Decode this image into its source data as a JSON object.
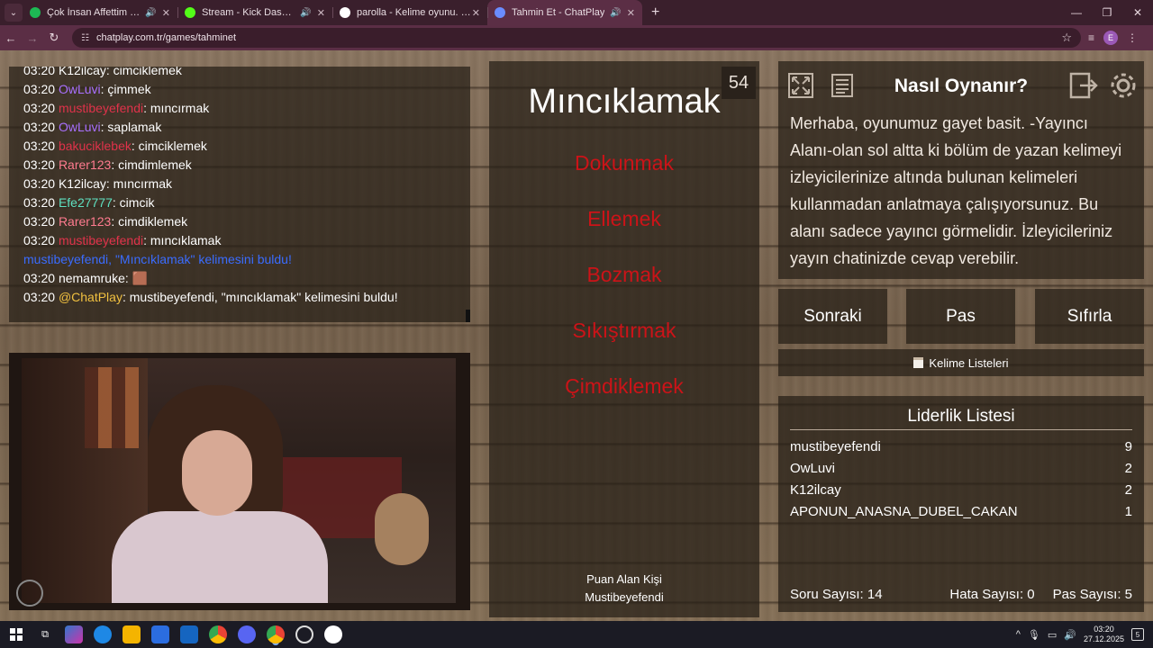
{
  "browser": {
    "tabs": [
      {
        "title": "Çok İnsan Affettim • Wegh",
        "color": "#1db954",
        "active": false
      },
      {
        "title": "Stream - Kick Dashboard",
        "color": "#53fc18",
        "active": false
      },
      {
        "title": "parolla - Kelime oyunu. Günlük",
        "color": "#ffffff",
        "active": false
      },
      {
        "title": "Tahmin Et - ChatPlay",
        "color": "#6a8cff",
        "active": true
      }
    ],
    "url": "chatplay.com.tr/games/tahminet",
    "profile_initial": "E"
  },
  "chat": {
    "lines": [
      {
        "time": "03:20",
        "user": "K12ilcay",
        "color": "#ffffff",
        "message": ": cimciklemek"
      },
      {
        "time": "03:20",
        "user": "OwLuvi",
        "color": "#a970ff",
        "message": ": çimmek"
      },
      {
        "time": "03:20",
        "user": "mustibeyefendi",
        "color": "#e0324a",
        "message": ": mıncırmak"
      },
      {
        "time": "03:20",
        "user": "OwLuvi",
        "color": "#a970ff",
        "message": ": saplamak"
      },
      {
        "time": "03:20",
        "user": "bakuciklebek",
        "color": "#e0324a",
        "message": ": cimciklemek"
      },
      {
        "time": "03:20",
        "user": "Rarer123",
        "color": "#ff7b8f",
        "message": ": cimdimlemek"
      },
      {
        "time": "03:20",
        "user": "K12ilcay",
        "color": "#ffffff",
        "message": ": mıncırmak"
      },
      {
        "time": "03:20",
        "user": "Efe27777",
        "color": "#5ee0c0",
        "message": ": cimcik"
      },
      {
        "time": "03:20",
        "user": "Rarer123",
        "color": "#ff7b8f",
        "message": ": cimdiklemek"
      },
      {
        "time": "03:20",
        "user": "mustibeyefendi",
        "color": "#e0324a",
        "message": ": mıncıklamak"
      },
      {
        "time": "",
        "user": "mustibeyefendi, \"Mıncıklamak\" kelimesini buldu!",
        "color": "#3a6cff",
        "message": ""
      },
      {
        "time": "03:20",
        "user": "nemamruke",
        "color": "#ffffff",
        "message": ": 🟫"
      },
      {
        "time": "03:20",
        "user": "@ChatPlay",
        "color": "#f0c040",
        "message": ": mustibeyefendi, \"mıncıklamak\" kelimesini buldu!"
      }
    ]
  },
  "game": {
    "timer": "54",
    "word": "Mıncıklamak",
    "forbidden": [
      "Dokunmak",
      "Ellemek",
      "Bozmak",
      "Sıkıştırmak",
      "Çimdiklemek"
    ],
    "forbidden_color": "#cc1318",
    "scorer_title": "Puan Alan Kişi",
    "scorer_name": "Mustibeyefendi"
  },
  "howto": {
    "title": "Nasıl Oynanır?",
    "text": "Merhaba, oyunumuz gayet basit. -Yayıncı Alanı-olan sol altta ki bölüm de yazan kelimeyi izleyicilerinize altında bulunan kelimeleri kullanmadan anlatmaya çalışıyorsunuz. Bu alanı sadece yayıncı görmelidir. İzleyicileriniz yayın chatinizde cevap verebilir."
  },
  "buttons": {
    "next": "Sonraki",
    "pass": "Pas",
    "reset": "Sıfırla",
    "word_lists": "Kelime Listeleri"
  },
  "leaderboard": {
    "title": "Liderlik Listesi",
    "rows": [
      {
        "name": "mustibeyefendi",
        "score": "9"
      },
      {
        "name": "OwLuvi",
        "score": "2"
      },
      {
        "name": "K12ilcay",
        "score": "2"
      },
      {
        "name": "APONUN_ANASNA_DUBEL_CAKAN",
        "score": "1"
      }
    ],
    "questions": "Soru Sayısı: 14",
    "errors": "Hata Sayısı: 0",
    "passes": "Pas Sayısı: 5"
  },
  "taskbar": {
    "time": "03:20",
    "date": "27.12.2025",
    "notifications": "5"
  }
}
